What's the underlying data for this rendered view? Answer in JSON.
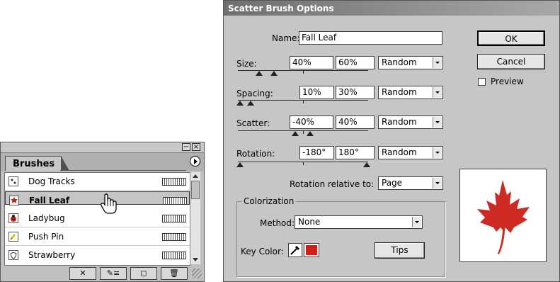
{
  "brushes_panel": {
    "tab_label": "Brushes",
    "items": [
      {
        "label": "Dog Tracks",
        "selected": false
      },
      {
        "label": "Fall Leaf",
        "selected": true
      },
      {
        "label": "Ladybug",
        "selected": false
      },
      {
        "label": "Push Pin",
        "selected": false
      },
      {
        "label": "Strawberry",
        "selected": false
      }
    ],
    "minimize_glyph": "−",
    "close_glyph": "×",
    "bottom_buttons": [
      {
        "name": "remove-brush-stroke",
        "glyph": "✕"
      },
      {
        "name": "brush-options",
        "glyph": "✎≡"
      },
      {
        "name": "new-brush",
        "glyph": "◻"
      },
      {
        "name": "delete-brush",
        "glyph": "🗑"
      }
    ],
    "cursor_icon": "hand-pointer-icon"
  },
  "dialog": {
    "title": "Scatter Brush Options",
    "name_label": "Name:",
    "name_value": "Fall Leaf",
    "size": {
      "label": "Size:",
      "min": "40%",
      "max": "60%",
      "mode": "Random"
    },
    "spacing": {
      "label": "Spacing:",
      "min": "10%",
      "max": "30%",
      "mode": "Random"
    },
    "scatter": {
      "label": "Scatter:",
      "min": "-40%",
      "max": "40%",
      "mode": "Random"
    },
    "rotation": {
      "label": "Rotation:",
      "min": "-180°",
      "max": "180°",
      "mode": "Random"
    },
    "rotation_relative_label": "Rotation relative to:",
    "rotation_relative_value": "Page",
    "ok_label": "OK",
    "cancel_label": "Cancel",
    "preview_label": "Preview",
    "preview_checked": false,
    "colorization": {
      "group_title": "Colorization",
      "method_label": "Method:",
      "method_value": "None",
      "key_color_label": "Key Color:",
      "key_color": "#d0201a",
      "tips_label": "Tips"
    },
    "preview_image": "red-maple-leaf"
  }
}
